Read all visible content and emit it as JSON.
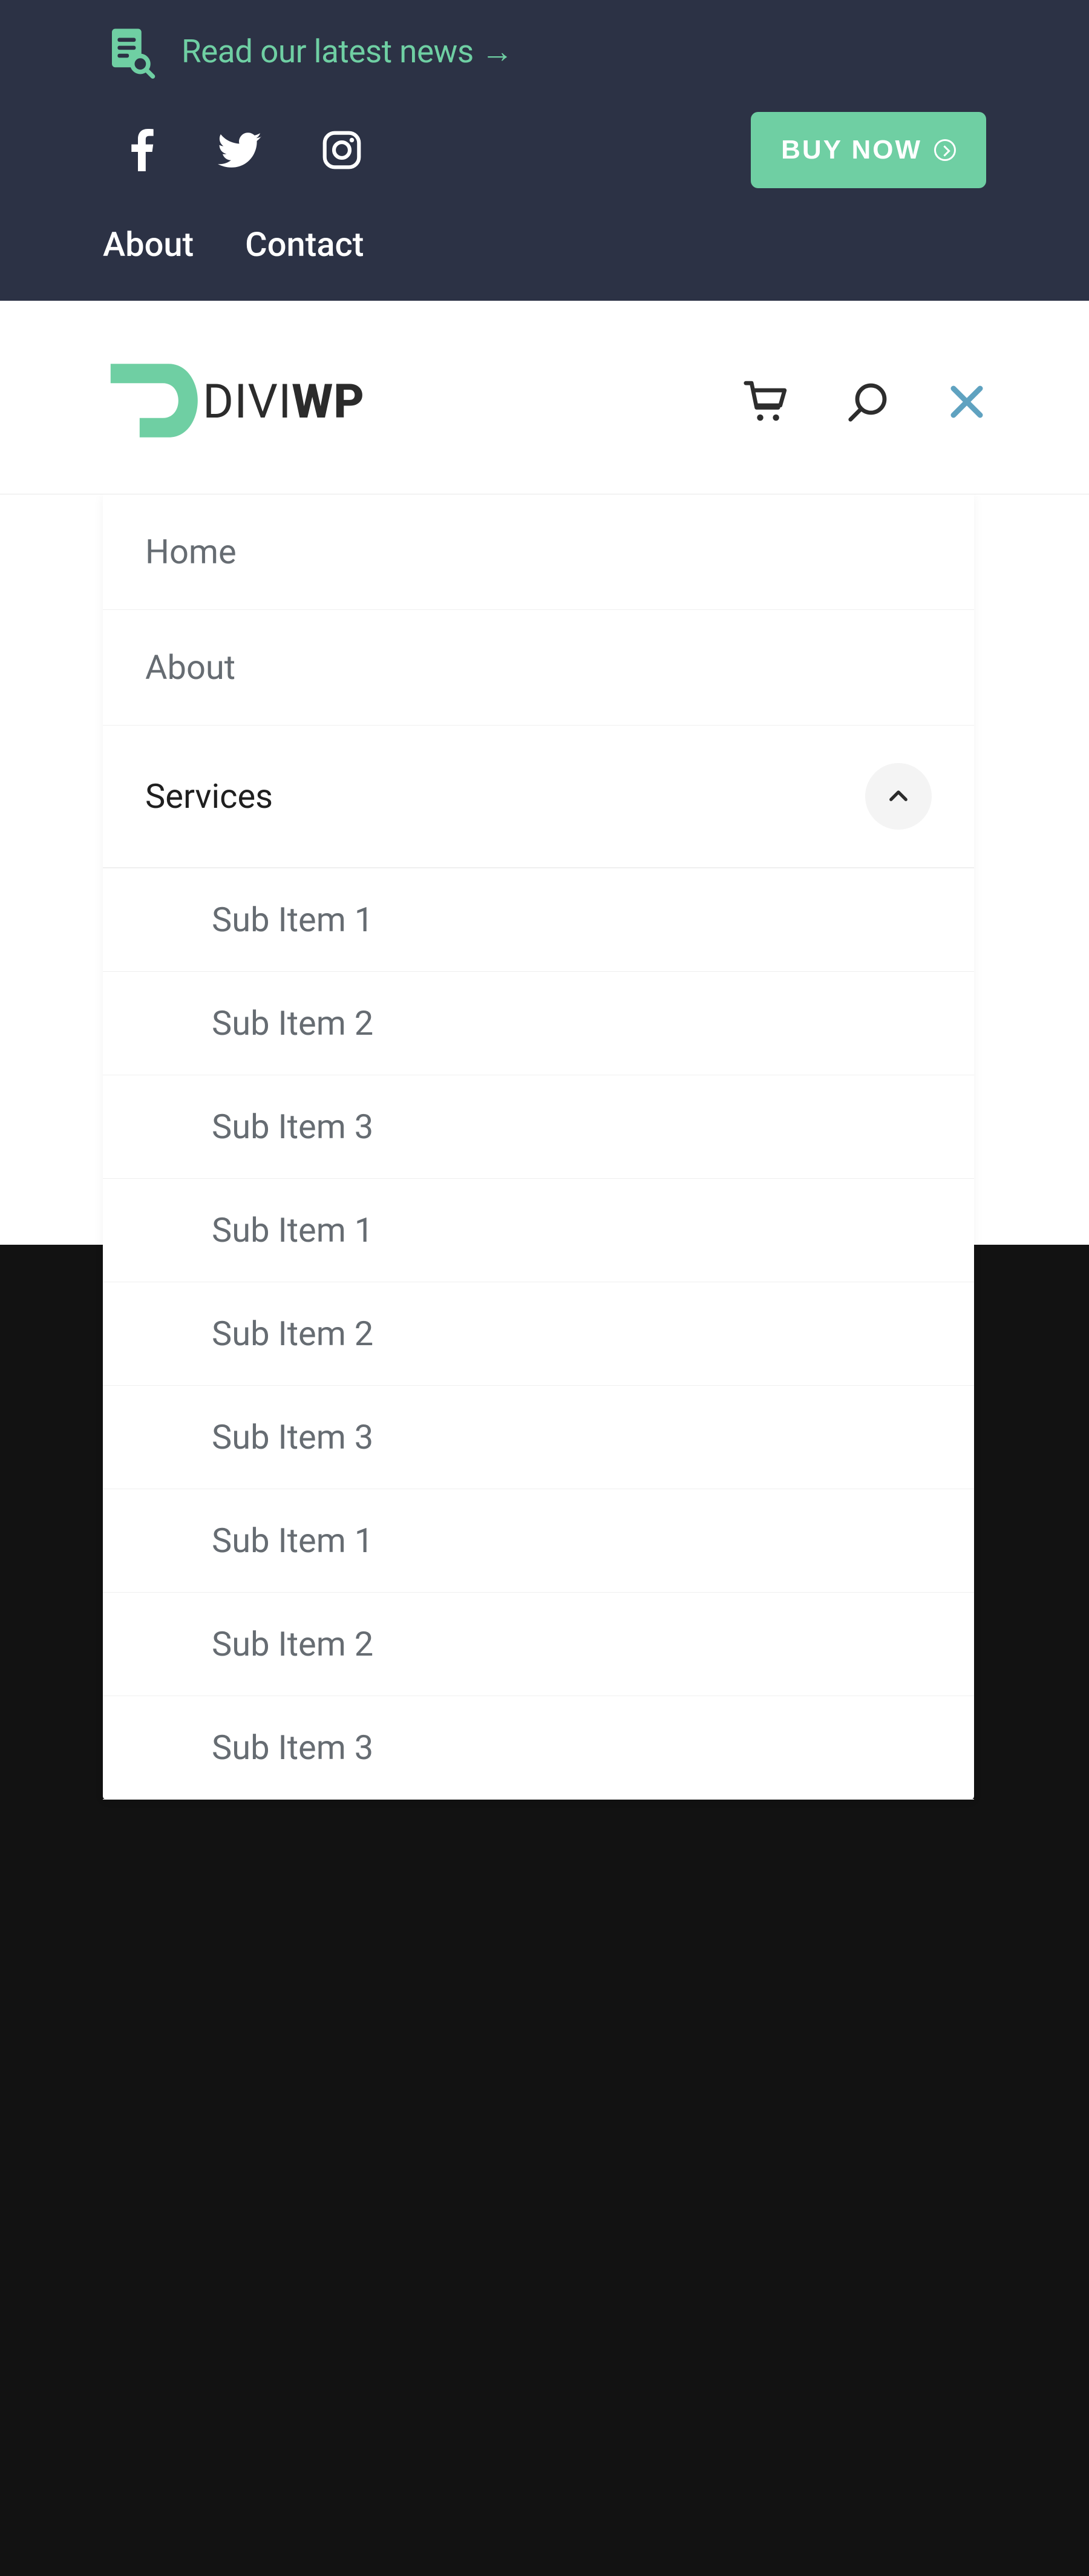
{
  "topbar": {
    "news_label": "Read our latest news →",
    "buy_label": "BUY NOW"
  },
  "topnav": {
    "about": "About",
    "contact": "Contact"
  },
  "logo": {
    "prefix": "DIVI",
    "suffix": "WP"
  },
  "menu": {
    "home": "Home",
    "about": "About",
    "services": "Services",
    "sub": [
      "Sub Item 1",
      "Sub Item 2",
      "Sub Item 3",
      "Sub Item 1",
      "Sub Item 2",
      "Sub Item 3",
      "Sub Item 1",
      "Sub Item 2",
      "Sub Item 3"
    ]
  },
  "colors": {
    "accent": "#6fcfa3",
    "dark": "#2c3245",
    "black": "#121212",
    "close": "#5fa2c0"
  }
}
